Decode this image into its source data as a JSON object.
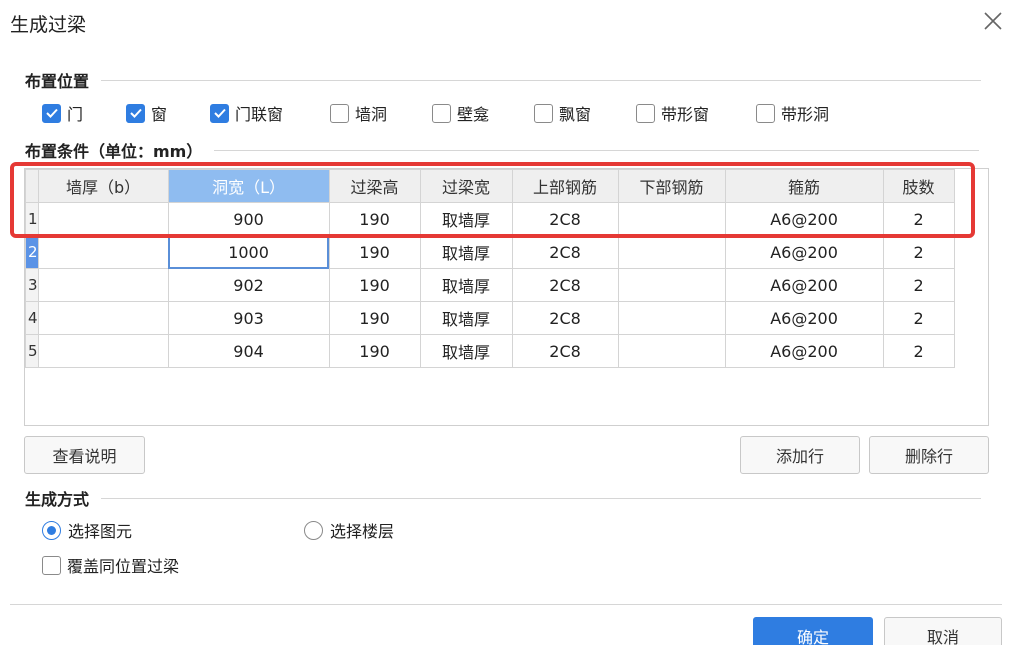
{
  "dialog": {
    "title": "生成过梁"
  },
  "placement": {
    "heading": "布置位置",
    "options": [
      {
        "label": "门",
        "checked": true
      },
      {
        "label": "窗",
        "checked": true
      },
      {
        "label": "门联窗",
        "checked": true
      },
      {
        "label": "墙洞",
        "checked": false
      },
      {
        "label": "壁龛",
        "checked": false
      },
      {
        "label": "飘窗",
        "checked": false
      },
      {
        "label": "带形窗",
        "checked": false
      },
      {
        "label": "带形洞",
        "checked": false
      }
    ]
  },
  "conditions": {
    "heading": "布置条件（单位：mm）",
    "columns": [
      "墙厚（b）",
      "洞宽（L）",
      "过梁高",
      "过梁宽",
      "上部钢筋",
      "下部钢筋",
      "箍筋",
      "肢数"
    ],
    "rows": [
      {
        "num": "1",
        "cells": [
          "",
          "900",
          "190",
          "取墙厚",
          "2C8",
          "",
          "A6@200",
          "2"
        ]
      },
      {
        "num": "2",
        "cells": [
          "",
          "1000",
          "190",
          "取墙厚",
          "2C8",
          "",
          "A6@200",
          "2"
        ]
      },
      {
        "num": "3",
        "cells": [
          "",
          "902",
          "190",
          "取墙厚",
          "2C8",
          "",
          "A6@200",
          "2"
        ]
      },
      {
        "num": "4",
        "cells": [
          "",
          "903",
          "190",
          "取墙厚",
          "2C8",
          "",
          "A6@200",
          "2"
        ]
      },
      {
        "num": "5",
        "cells": [
          "",
          "904",
          "190",
          "取墙厚",
          "2C8",
          "",
          "A6@200",
          "2"
        ]
      }
    ]
  },
  "buttons": {
    "view_help": "查看说明",
    "add_row": "添加行",
    "delete_row": "删除行",
    "ok": "确定",
    "cancel": "取消"
  },
  "generate": {
    "heading": "生成方式",
    "radios": [
      {
        "label": "选择图元",
        "selected": true
      },
      {
        "label": "选择楼层",
        "selected": false
      }
    ],
    "overwrite_label": "覆盖同位置过梁",
    "overwrite_checked": false
  },
  "colors": {
    "accent": "#2f7de1",
    "highlight": "#e53935",
    "header_active": "#8fbcf0"
  }
}
